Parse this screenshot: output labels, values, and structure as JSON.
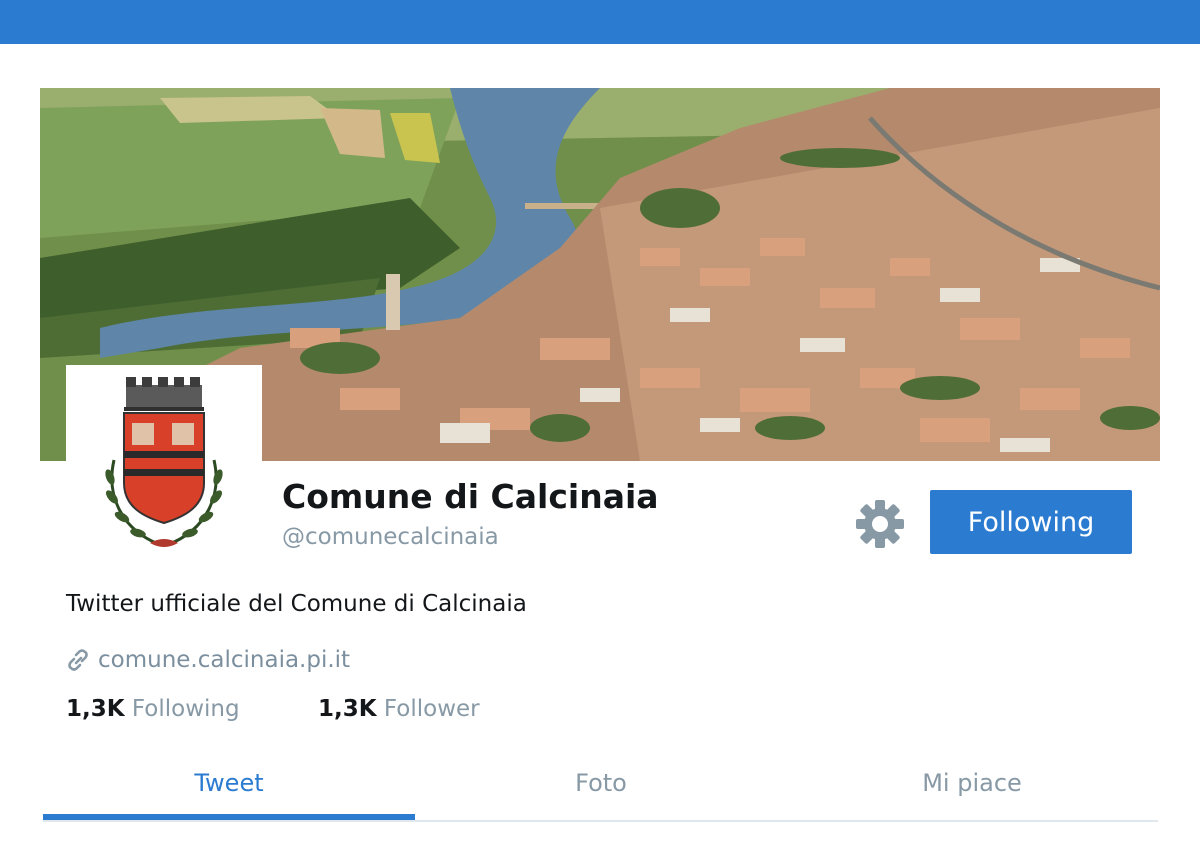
{
  "profile": {
    "name": "Comune di Calcinaia",
    "handle": "@comunecalcinaia",
    "bio": "Twitter ufficiale del Comune di Calcinaia",
    "website": "comune.calcinaia.pi.it"
  },
  "actions": {
    "settings_icon": "gear-icon",
    "follow_label": "Following"
  },
  "stats": {
    "following": {
      "count": "1,3K",
      "label": "Following"
    },
    "followers": {
      "count": "1,3K",
      "label": "Follower"
    }
  },
  "tabs": [
    {
      "label": "Tweet",
      "active": true
    },
    {
      "label": "Foto",
      "active": false
    },
    {
      "label": "Mi piace",
      "active": false
    }
  ],
  "icons": {
    "link": "link-icon",
    "avatar": "coat-of-arms"
  },
  "colors": {
    "accent": "#2b7bd0",
    "muted_text": "#8899a6",
    "primary_text": "#14171a"
  }
}
